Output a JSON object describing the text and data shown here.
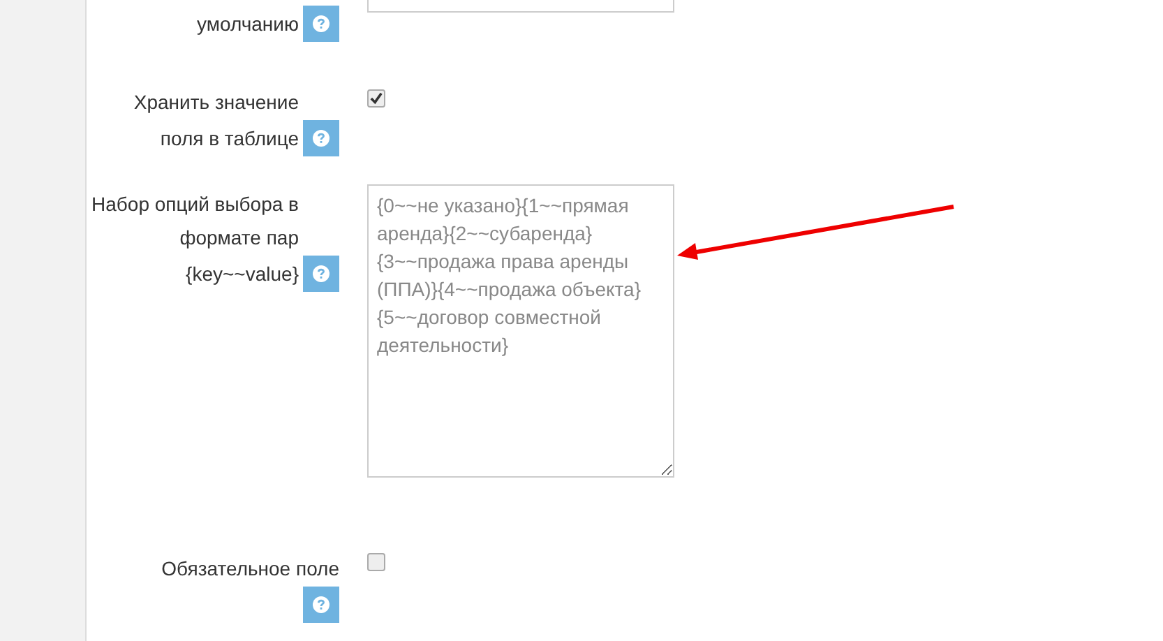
{
  "rows": [
    {
      "kind": "text",
      "label_lines": [
        "умолчанию"
      ]
    },
    {
      "kind": "checkbox",
      "label_lines": [
        "Хранить значение",
        "поля в таблице"
      ],
      "checked": true
    },
    {
      "kind": "textarea",
      "label_lines": [
        "Набор опций выбора в",
        "формате пар",
        "{key~~value}"
      ],
      "value": "{0~~не указано}{1~~прямая аренда}{2~~субаренда}{3~~продажа права аренды (ППА)}{4~~продажа объекта}{5~~договор совместной деятельности}"
    },
    {
      "kind": "checkbox",
      "label_lines": [
        "Обязательное поле"
      ],
      "checked": false
    }
  ]
}
